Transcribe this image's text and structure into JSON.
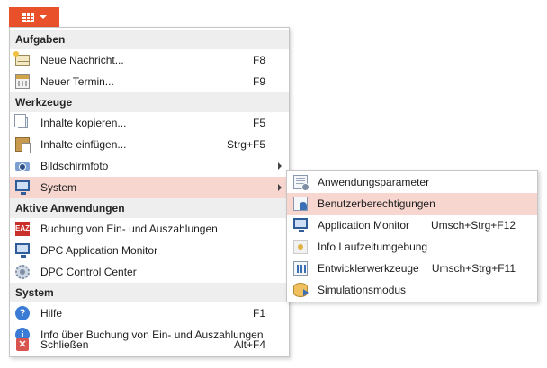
{
  "app_button": {
    "icon": "grid-icon",
    "caret": "chevron-down-icon",
    "accent": "#e8512a"
  },
  "main_menu": {
    "sections": [
      {
        "header": "Aufgaben",
        "items": [
          {
            "label": "Neue Nachricht...",
            "shortcut": "F8",
            "icon": "new-message-icon"
          },
          {
            "label": "Neuer Termin...",
            "shortcut": "F9",
            "icon": "new-appointment-icon"
          }
        ]
      },
      {
        "header": "Werkzeuge",
        "items": [
          {
            "label": "Inhalte kopieren...",
            "shortcut": "F5",
            "icon": "copy-icon"
          },
          {
            "label": "Inhalte einfügen...",
            "shortcut": "Strg+F5",
            "icon": "paste-icon"
          },
          {
            "label": "Bildschirmfoto",
            "shortcut": "",
            "icon": "camera-icon",
            "submenu": true
          },
          {
            "label": "System",
            "shortcut": "",
            "icon": "monitor-icon",
            "submenu": true,
            "highlighted": true
          }
        ]
      },
      {
        "header": "Aktive Anwendungen",
        "items": [
          {
            "label": "Buchung von Ein- und Auszahlungen",
            "shortcut": "",
            "icon": "eaz-icon",
            "icon_text": "EAZ"
          },
          {
            "label": "DPC Application Monitor",
            "shortcut": "",
            "icon": "monitor-icon"
          },
          {
            "label": "DPC Control Center",
            "shortcut": "",
            "icon": "gear-icon"
          }
        ]
      },
      {
        "header": "System",
        "items": [
          {
            "label": "Hilfe",
            "shortcut": "F1",
            "icon": "help-icon",
            "icon_text": "?"
          },
          {
            "label": "Info über Buchung von Ein- und Auszahlungen",
            "shortcut": "",
            "icon": "info-icon",
            "icon_text": "i"
          },
          {
            "label": "Schließen",
            "shortcut": "Alt+F4",
            "icon": "close-icon",
            "icon_text": "✕"
          }
        ]
      }
    ]
  },
  "system_submenu": {
    "items": [
      {
        "label": "Anwendungsparameter",
        "shortcut": "",
        "icon": "parameters-icon"
      },
      {
        "label": "Benutzerberechtigungen",
        "shortcut": "",
        "icon": "user-permissions-icon",
        "highlighted": true
      },
      {
        "label": "Application Monitor",
        "shortcut": "Umsch+Strg+F12",
        "icon": "monitor-icon"
      },
      {
        "label": "Info Laufzeitumgebung",
        "shortcut": "",
        "icon": "runtime-info-icon"
      },
      {
        "label": "Entwicklerwerkzeuge",
        "shortcut": "Umsch+Strg+F11",
        "icon": "developer-tools-icon"
      },
      {
        "label": "Simulationsmodus",
        "shortcut": "",
        "icon": "simulation-icon"
      }
    ]
  },
  "colors": {
    "highlight": "#f6d6cf",
    "section_header_bg": "#eeeeee",
    "accent": "#e8512a"
  }
}
